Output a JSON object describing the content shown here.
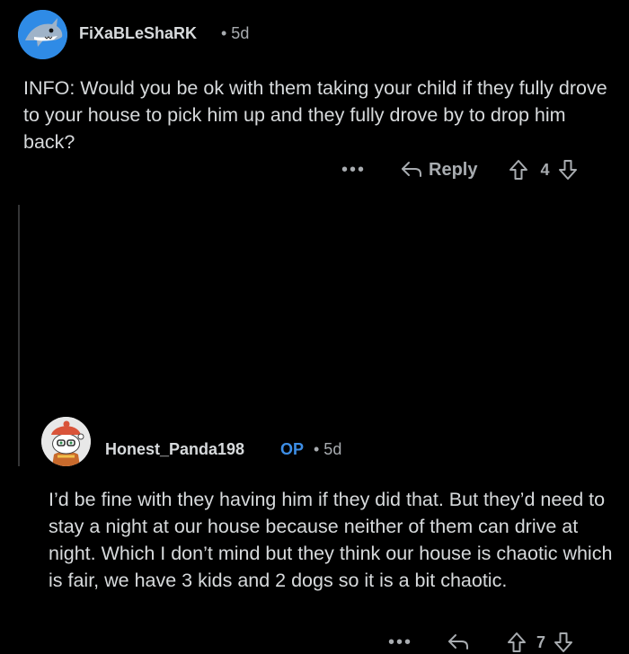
{
  "comments": [
    {
      "username": "FiXaBLeShaRK",
      "meta": "• 5d",
      "body": "INFO: Would you be ok with them taking your child if they fully drove to your house to pick him up and they fully drove by to drop him back?",
      "more": "•••",
      "reply_label": "Reply",
      "score": "4",
      "avatar_icon": "shark-avatar-icon",
      "avatar_color": "#2f8be6"
    },
    {
      "username": "Honest_Panda198",
      "op_badge": "OP",
      "meta": "• 5d",
      "body": "I’d be fine with they having him if they did that. But they’d need to stay a night at our house because neither of them can drive at night. Which I don’t mind but they think our house is chaotic which is fair, we have 3 kids and 2 dogs so it is a bit chaotic.",
      "more": "•••",
      "score": "7",
      "avatar_icon": "snoo-avatar-icon",
      "op_color": "#3d8ee6"
    }
  ],
  "colors": {
    "background": "#000000",
    "text": "#d7dadc",
    "muted": "#a8acb0",
    "op_accent": "#3d8ee6"
  }
}
